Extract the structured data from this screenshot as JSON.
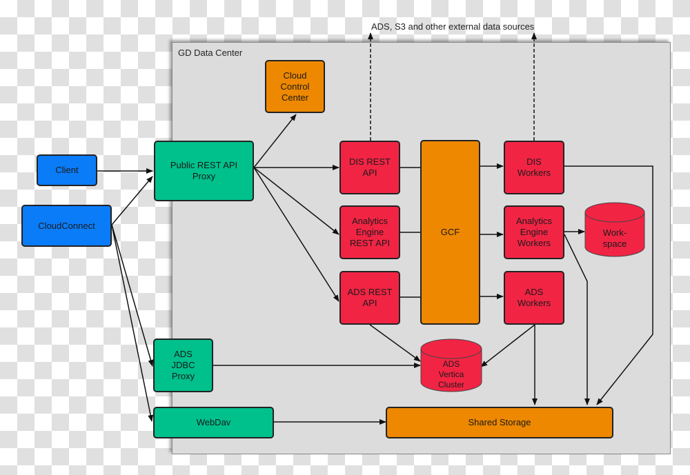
{
  "diagram": {
    "external_label": "ADS, S3 and other external data sources",
    "container_title": "GD Data Center",
    "colors": {
      "client": "#0a7cf8",
      "proxy": "#00c08b",
      "service": "#f22444",
      "core": "#ee8800",
      "container": "#dcdcdc"
    },
    "nodes": {
      "client": "Client",
      "cloudconnect": "CloudConnect",
      "public_rest_api_proxy": "Public REST API\nProxy",
      "cloud_control_center": "Cloud\nControl\nCenter",
      "dis_rest_api": "DIS REST\nAPI",
      "analytics_engine_rest_api": "Analytics\nEngine\nREST API",
      "ads_rest_api": "ADS REST\nAPI",
      "gcf": "GCF",
      "dis_workers": "DIS\nWorkers",
      "analytics_engine_workers": "Analytics\nEngine\nWorkers",
      "ads_workers": "ADS\nWorkers",
      "workspace": "Work-\nspace",
      "ads_vertica_cluster": "ADS\nVertica\nCluster",
      "ads_jdbc_proxy": "ADS\nJDBC\nProxy",
      "webdav": "WebDav",
      "shared_storage": "Shared Storage"
    },
    "edges": [
      {
        "from": "Client",
        "to": "Public REST API Proxy"
      },
      {
        "from": "CloudConnect",
        "to": "Public REST API Proxy"
      },
      {
        "from": "CloudConnect",
        "to": "ADS JDBC Proxy"
      },
      {
        "from": "CloudConnect",
        "to": "WebDav"
      },
      {
        "from": "Public REST API Proxy",
        "to": "Cloud Control Center"
      },
      {
        "from": "Public REST API Proxy",
        "to": "DIS REST API"
      },
      {
        "from": "Public REST API Proxy",
        "to": "Analytics Engine REST API"
      },
      {
        "from": "Public REST API Proxy",
        "to": "ADS REST API"
      },
      {
        "from": "DIS REST API",
        "to": "GCF"
      },
      {
        "from": "Analytics Engine REST API",
        "to": "GCF"
      },
      {
        "from": "ADS REST API",
        "to": "GCF"
      },
      {
        "from": "GCF",
        "to": "DIS Workers"
      },
      {
        "from": "GCF",
        "to": "Analytics Engine Workers"
      },
      {
        "from": "GCF",
        "to": "ADS Workers"
      },
      {
        "from": "Analytics Engine Workers",
        "to": "Workspace"
      },
      {
        "from": "ADS REST API",
        "to": "ADS Vertica Cluster"
      },
      {
        "from": "ADS Workers",
        "to": "ADS Vertica Cluster"
      },
      {
        "from": "ADS JDBC Proxy",
        "to": "ADS Vertica Cluster"
      },
      {
        "from": "ADS Workers",
        "to": "Shared Storage"
      },
      {
        "from": "Analytics Engine Workers",
        "to": "Shared Storage"
      },
      {
        "from": "DIS Workers",
        "to": "Shared Storage"
      },
      {
        "from": "WebDav",
        "to": "Shared Storage"
      },
      {
        "from": "DIS REST API",
        "to": "ADS, S3 and other external data sources",
        "style": "dashed"
      },
      {
        "from": "DIS Workers",
        "to": "ADS, S3 and other external data sources",
        "style": "dashed"
      }
    ]
  }
}
